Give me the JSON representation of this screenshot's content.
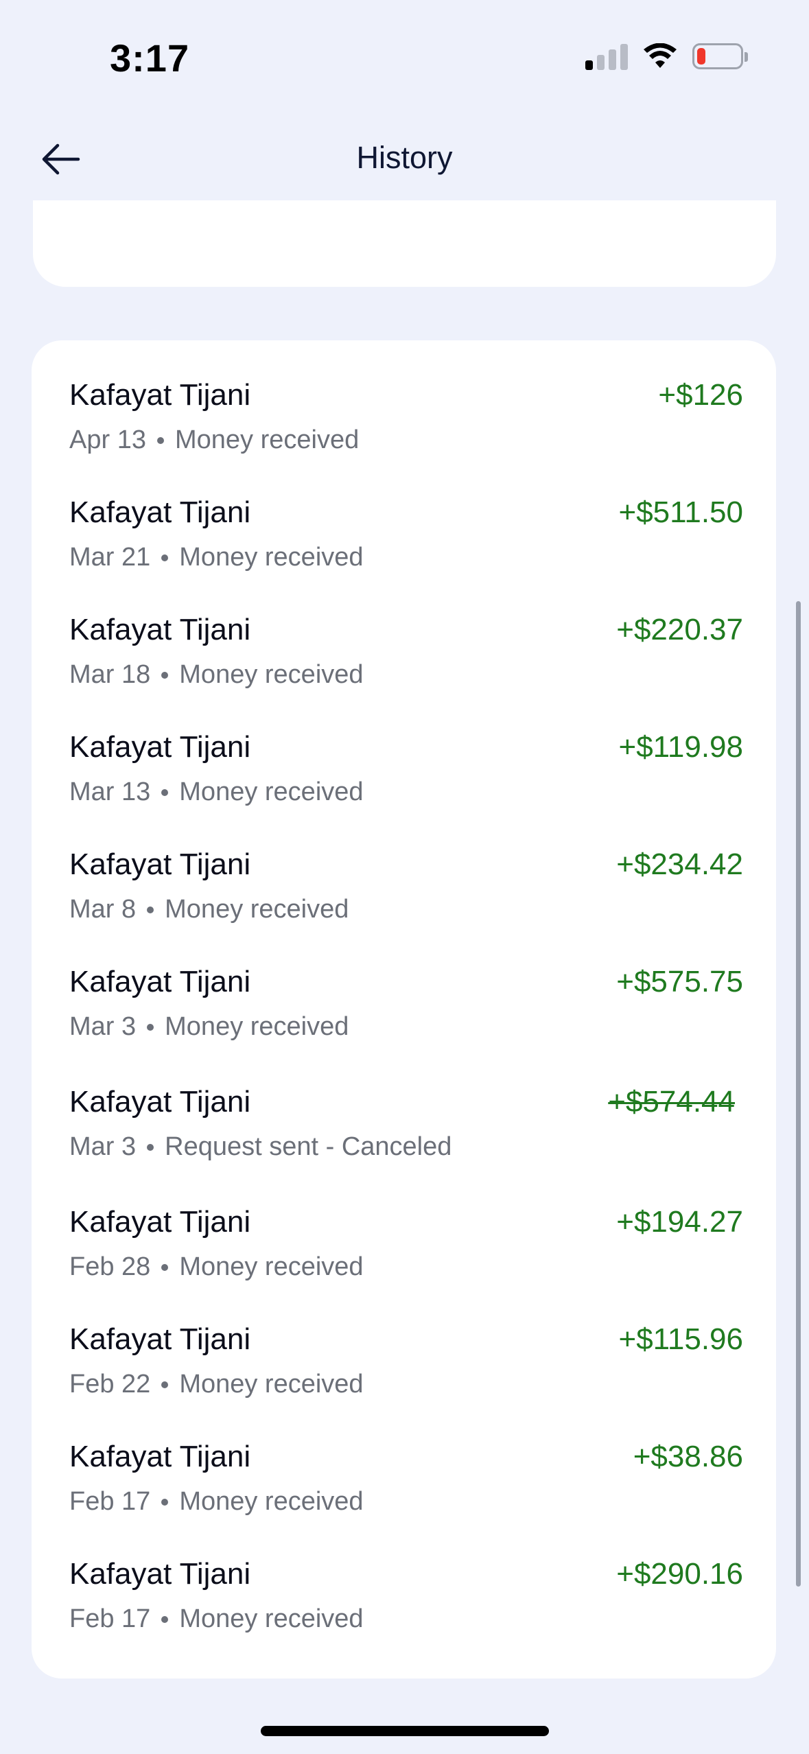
{
  "status_bar": {
    "time": "3:17",
    "signal_icon": "cellular-signal-icon",
    "wifi_icon": "wifi-icon",
    "battery_icon": "battery-low-icon"
  },
  "header": {
    "back_icon": "arrow-left-icon",
    "title": "History"
  },
  "colors": {
    "background": "#eef1fb",
    "card": "#ffffff",
    "amount_positive": "#1f7a1f",
    "meta_text": "#6b6f78",
    "battery_low": "#f0372b"
  },
  "transactions": [
    {
      "name": "Kafayat Tijani",
      "date": "Apr 13",
      "status": "Money received",
      "amount": "+$126"
    },
    {
      "name": "Kafayat Tijani",
      "date": "Mar 21",
      "status": "Money received",
      "amount": "+$511.50"
    },
    {
      "name": "Kafayat Tijani",
      "date": "Mar 18",
      "status": "Money received",
      "amount": "+$220.37"
    },
    {
      "name": "Kafayat Tijani",
      "date": "Mar 13",
      "status": "Money received",
      "amount": "+$119.98"
    },
    {
      "name": "Kafayat Tijani",
      "date": "Mar 8",
      "status": "Money received",
      "amount": "+$234.42"
    },
    {
      "name": "Kafayat Tijani",
      "date": "Mar 3",
      "status": "Money received",
      "amount": "+$575.75"
    },
    {
      "name": "Kafayat Tijani",
      "date": "Mar 3",
      "status": "Request sent - Canceled",
      "amount": "+$574.44",
      "canceled": true
    },
    {
      "name": "Kafayat Tijani",
      "date": "Feb 28",
      "status": "Money received",
      "amount": "+$194.27"
    },
    {
      "name": "Kafayat Tijani",
      "date": "Feb 22",
      "status": "Money received",
      "amount": "+$115.96"
    },
    {
      "name": "Kafayat Tijani",
      "date": "Feb 17",
      "status": "Money received",
      "amount": "+$38.86"
    },
    {
      "name": "Kafayat Tijani",
      "date": "Feb 17",
      "status": "Money received",
      "amount": "+$290.16"
    }
  ]
}
